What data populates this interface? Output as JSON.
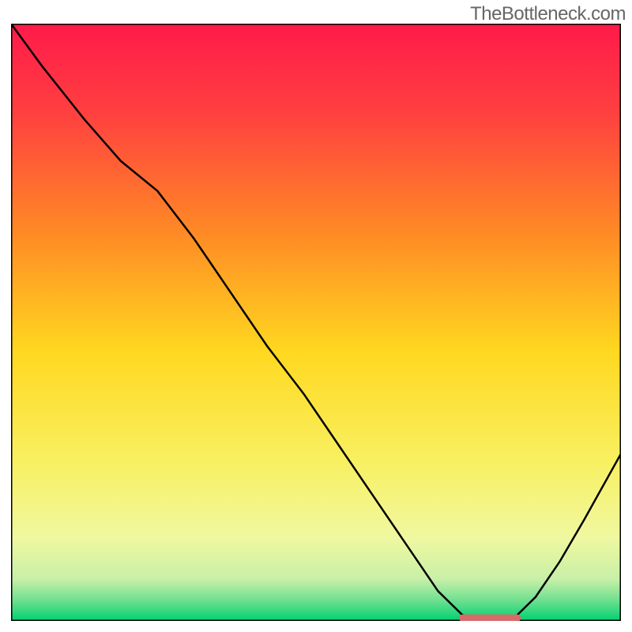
{
  "watermark": "TheBottleneck.com",
  "chart_data": {
    "type": "line",
    "title": "",
    "xlabel": "",
    "ylabel": "",
    "xlim": [
      0,
      100
    ],
    "ylim": [
      0,
      100
    ],
    "grid": false,
    "legend": false,
    "background_gradient": {
      "stops": [
        {
          "offset": 0.0,
          "color": "#ff1a4a"
        },
        {
          "offset": 0.15,
          "color": "#ff4040"
        },
        {
          "offset": 0.35,
          "color": "#ff8a25"
        },
        {
          "offset": 0.55,
          "color": "#ffd820"
        },
        {
          "offset": 0.73,
          "color": "#f8f060"
        },
        {
          "offset": 0.86,
          "color": "#f0f8a0"
        },
        {
          "offset": 0.93,
          "color": "#c8f0a8"
        },
        {
          "offset": 0.965,
          "color": "#70e090"
        },
        {
          "offset": 1.0,
          "color": "#00d070"
        }
      ]
    },
    "series": [
      {
        "name": "bottleneck-curve",
        "type": "line",
        "stroke": "#000000",
        "stroke_width": 2.5,
        "x": [
          0.0,
          5,
          12,
          18,
          24,
          30,
          36,
          42,
          48,
          54,
          60,
          66,
          70,
          74,
          78,
          82,
          86,
          90,
          94,
          100
        ],
        "y": [
          100,
          93,
          84,
          77,
          72,
          64,
          55,
          46,
          38,
          29,
          20,
          11,
          5,
          1,
          0,
          0,
          4,
          10,
          17,
          28
        ]
      },
      {
        "name": "optimal-marker",
        "type": "segment",
        "stroke": "#d96a6a",
        "stroke_width": 9,
        "linecap": "round",
        "x": [
          74,
          83
        ],
        "y": [
          0.5,
          0.5
        ]
      }
    ],
    "annotations": []
  }
}
